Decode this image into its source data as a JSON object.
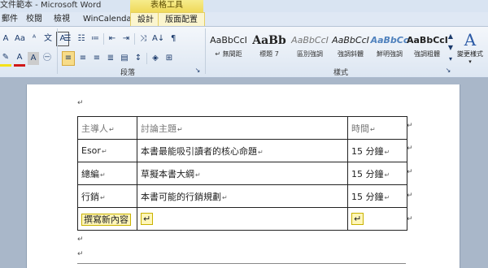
{
  "window": {
    "title": "文件範本 - Microsoft Word",
    "context_tab_group": "表格工具"
  },
  "tabs": [
    {
      "label": "郵件"
    },
    {
      "label": "校閱"
    },
    {
      "label": "檢視"
    },
    {
      "label": "WinCalendar"
    },
    {
      "label": "設計"
    },
    {
      "label": "版面配置"
    }
  ],
  "ribbon": {
    "paragraph_group_label": "段落",
    "styles_group_label": "樣式",
    "change_styles_label": "變更樣式",
    "styles": [
      {
        "sample": "AaBbCcI",
        "name": "↵ 無間距"
      },
      {
        "sample": "AaBb",
        "name": "標題 7"
      },
      {
        "sample": "AaBbCcI",
        "name": "區別強調"
      },
      {
        "sample": "AaBbCcI",
        "name": "強調斜體"
      },
      {
        "sample": "AaBbCc",
        "name": "鮮明強調"
      },
      {
        "sample": "AaBbCcI",
        "name": "強調粗體"
      }
    ]
  },
  "document": {
    "table": {
      "headers": [
        "主導人",
        "討論主題",
        "時間"
      ],
      "rows": [
        [
          "Esor",
          "本書最能吸引讀者的核心命題",
          "15 分鐘"
        ],
        [
          "總編",
          "草擬本書大綱",
          "15 分鐘"
        ],
        [
          "行銷",
          "本書可能的行銷規劃",
          "15 分鐘"
        ]
      ],
      "new_row_first_cell": "撰寫新內容"
    }
  },
  "colors": {
    "accent_context_tab": "#f0dc6c",
    "ribbon_bg": "#dce6f2",
    "doc_bg": "#a9b7c9"
  }
}
